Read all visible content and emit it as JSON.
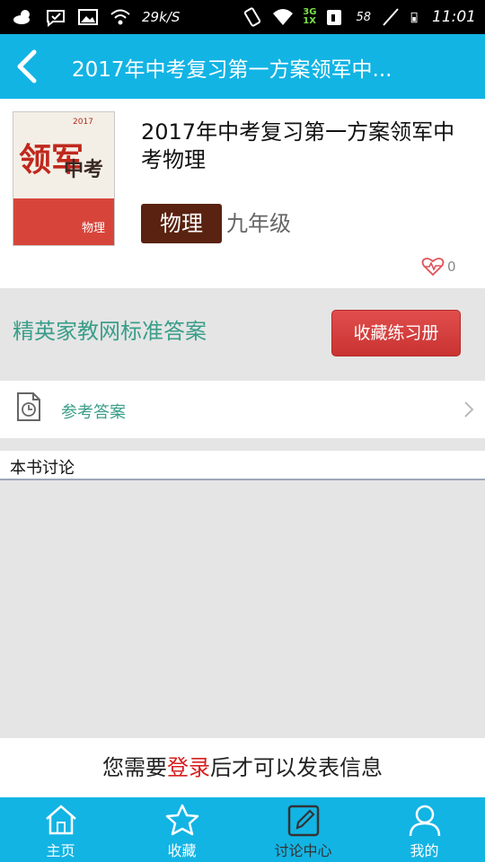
{
  "status_bar": {
    "net_speed": "29k/S",
    "network_type_top": "3G",
    "network_type_bottom": "1X",
    "battery": "58",
    "time": "11:01",
    "icons": [
      "weather-icon",
      "message-check-icon",
      "image-icon",
      "wifi-icon",
      "vibrate-icon",
      "wifi-icon",
      "signal-icon",
      "sim-icon",
      "battery-icon"
    ]
  },
  "header": {
    "title": "2017年中考复习第一方案领军中..."
  },
  "book": {
    "title": "2017年中考复习第一方案领军中考物理",
    "subject": "物理",
    "grade": "九年级",
    "likes": "0",
    "cover_title_1": "领军",
    "cover_title_2": "中考",
    "cover_small": "2017",
    "cover_subject": "物理"
  },
  "source": {
    "name": "精英家教网标准答案",
    "favorite_button": "收藏练习册"
  },
  "answer": {
    "label": "参考答案"
  },
  "discussion": {
    "title": "本书讨论"
  },
  "login_prompt": {
    "prefix": "您需要",
    "link": "登录",
    "suffix": "后才可以发表信息"
  },
  "tabs": [
    {
      "label": "主页",
      "icon": "home-icon"
    },
    {
      "label": "收藏",
      "icon": "star-icon"
    },
    {
      "label": "讨论中心",
      "icon": "edit-icon"
    },
    {
      "label": "我的",
      "icon": "user-icon"
    }
  ],
  "colors": {
    "primary": "#12b4e4",
    "accent_green": "#3a9e8a",
    "button_red": "#d23c3a",
    "login_red": "#d81e1e",
    "tag_brown": "#5a2210"
  }
}
